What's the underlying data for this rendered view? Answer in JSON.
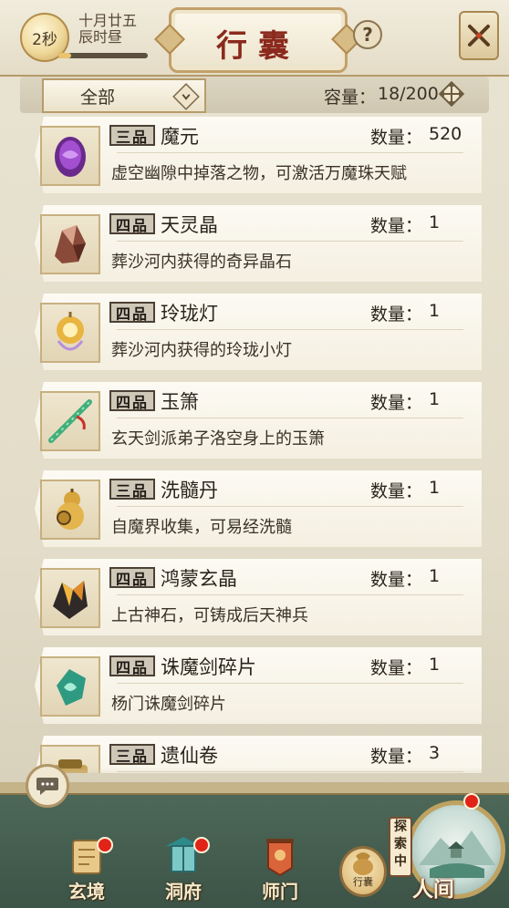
{
  "header": {
    "timer": "2秒",
    "date_line1": "十月廿五",
    "date_line2": "辰时昼",
    "timer_progress": 0.14,
    "title": "行囊",
    "help": "?"
  },
  "filter": {
    "selected": "全部",
    "capacity_label": "容量：",
    "capacity_value": "18/200"
  },
  "items": [
    {
      "grade": "三品",
      "name": "魔元",
      "qty_label": "数量：",
      "qty": "520",
      "desc": "虚空幽隙中掉落之物，可激活万魔珠天赋",
      "icon": "purple-demon-gem-icon"
    },
    {
      "grade": "四品",
      "name": "天灵晶",
      "qty_label": "数量：",
      "qty": "1",
      "desc": "葬沙河内获得的奇异晶石",
      "icon": "red-crystal-icon"
    },
    {
      "grade": "四品",
      "name": "玲珑灯",
      "qty_label": "数量：",
      "qty": "1",
      "desc": "葬沙河内获得的玲珑小灯",
      "icon": "golden-lantern-icon"
    },
    {
      "grade": "四品",
      "name": "玉箫",
      "qty_label": "数量：",
      "qty": "1",
      "desc": "玄天剑派弟子洛空身上的玉箫",
      "icon": "jade-flute-icon"
    },
    {
      "grade": "三品",
      "name": "洗髓丹",
      "qty_label": "数量：",
      "qty": "1",
      "desc": "自魔界收集，可易经洗髓",
      "icon": "gourd-pill-icon"
    },
    {
      "grade": "四品",
      "name": "鸿蒙玄晶",
      "qty_label": "数量：",
      "qty": "1",
      "desc": "上古神石，可铸成后天神兵",
      "icon": "black-gold-crystal-icon"
    },
    {
      "grade": "四品",
      "name": "诛魔剑碎片",
      "qty_label": "数量：",
      "qty": "1",
      "desc": "杨门诛魔剑碎片",
      "icon": "jade-sword-shard-icon"
    },
    {
      "grade": "三品",
      "name": "遗仙卷",
      "qty_label": "数量：",
      "qty": "3",
      "desc": "",
      "icon": "scroll-icon"
    }
  ],
  "nav": {
    "xuanjing": "玄境",
    "dongfu": "洞府",
    "shimen": "师门",
    "bag": "行囊",
    "explore": "探索中",
    "world": "人间"
  },
  "colors": {
    "title_red": "#8a2a1d",
    "badge_red": "#e02418",
    "bottom_green": "#4f6a5a"
  }
}
